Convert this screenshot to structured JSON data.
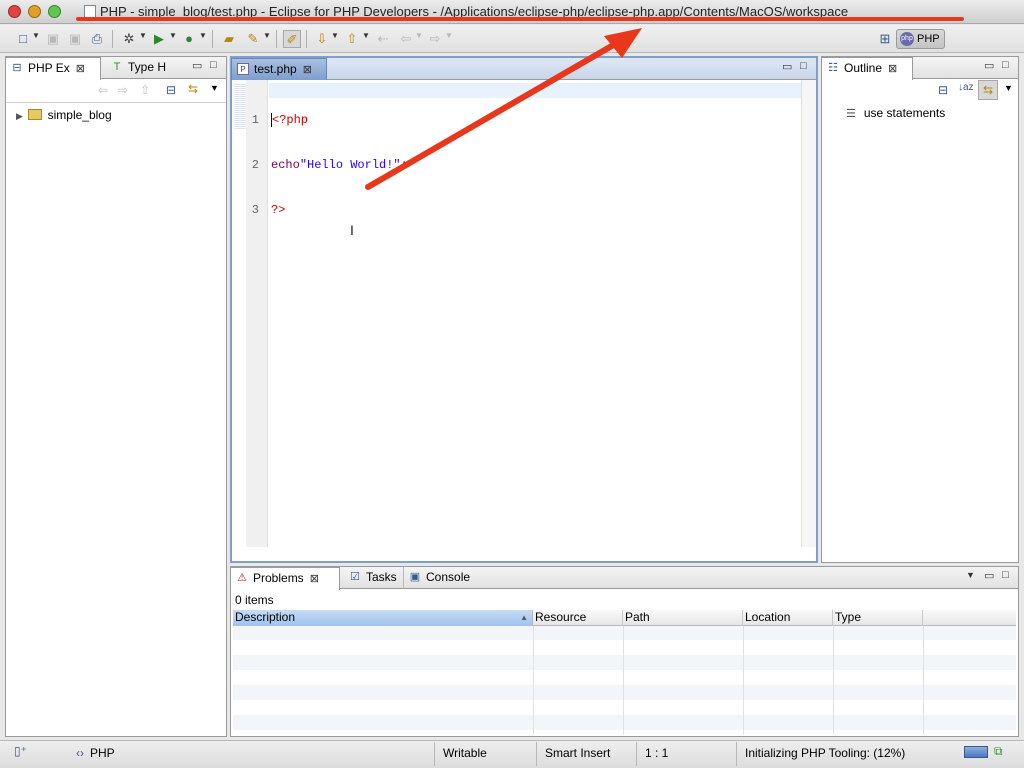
{
  "window": {
    "title": "PHP - simple_blog/test.php - Eclipse for PHP Developers - /Applications/eclipse-php/eclipse-php.app/Contents/MacOS/workspace"
  },
  "toolbar": {
    "perspective_label": "PHP",
    "icons": [
      "new-icon",
      "save-icon",
      "save-all-icon",
      "print-icon",
      "debug-icon",
      "run-icon",
      "external-tools-icon",
      "open-project-icon",
      "search-icon",
      "toggle-mark-icon",
      "next-annotation-icon",
      "prev-annotation-icon",
      "back-icon",
      "forward-icon"
    ]
  },
  "explorer": {
    "tabs": [
      {
        "label": "PHP Ex"
      },
      {
        "label": "Type H"
      }
    ],
    "tree": [
      {
        "label": "simple_blog"
      }
    ]
  },
  "editor": {
    "tab_label": "test.php",
    "lines": [
      {
        "num": "1",
        "tokens": [
          {
            "text": "<?php",
            "color": "#cc0000"
          }
        ]
      },
      {
        "num": "2",
        "tokens": [
          {
            "text": "echo",
            "color": "#7f0055"
          },
          {
            "text": "\"Hello World!\"",
            "color": "#2a00ff"
          },
          {
            "text": ";",
            "color": "#000000"
          }
        ]
      },
      {
        "num": "3",
        "tokens": [
          {
            "text": "?>",
            "color": "#cc0000"
          }
        ]
      }
    ]
  },
  "outline": {
    "tab_label": "Outline",
    "items": [
      {
        "label": "use statements"
      }
    ]
  },
  "bottom": {
    "tabs": [
      {
        "label": "Problems"
      },
      {
        "label": "Tasks"
      },
      {
        "label": "Console"
      }
    ],
    "count": "0 items",
    "columns": [
      "Description",
      "Resource",
      "Path",
      "Location",
      "Type"
    ]
  },
  "statusbar": {
    "lang": "PHP",
    "writable": "Writable",
    "insert_mode": "Smart Insert",
    "position": "1 : 1",
    "progress_text": "Initializing PHP Tooling: (12%)"
  },
  "colors": {
    "accent": "#e8371b",
    "selection": "#7e9ece"
  }
}
